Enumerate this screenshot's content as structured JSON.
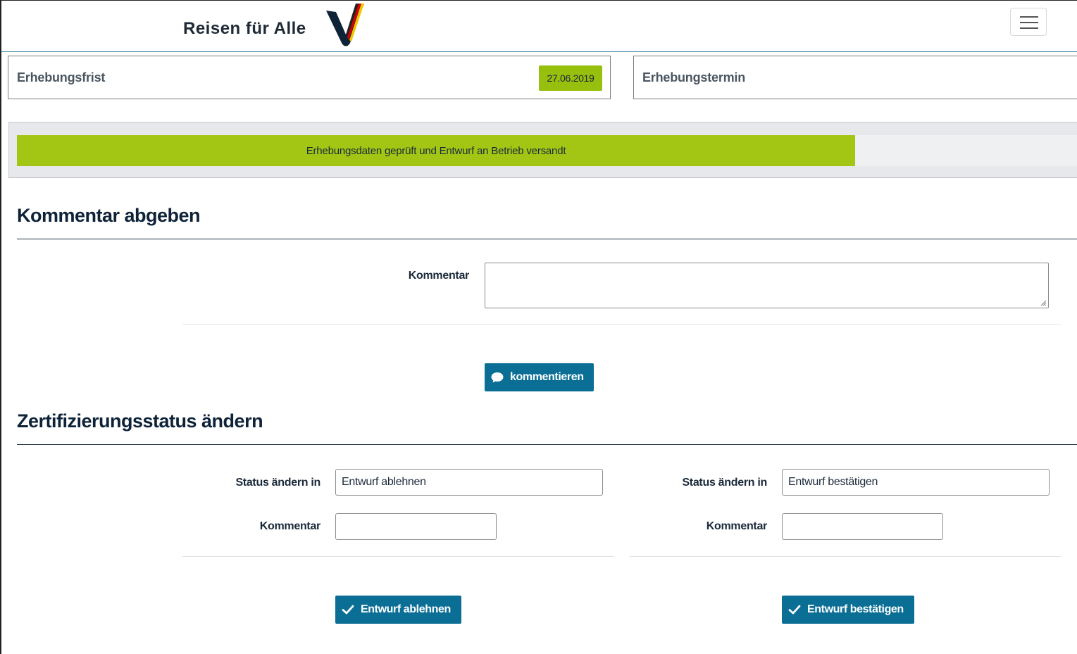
{
  "header": {
    "logo_text": "Reisen für Alle"
  },
  "info": {
    "erhebungsfrist_label": "Erhebungsfrist",
    "erhebungsfrist_date": "27.06.2019",
    "erhebungstermin_label": "Erhebungstermin"
  },
  "progress": {
    "label": "Erhebungsdaten geprüft und Entwurf an Betrieb versandt",
    "fraction": 0.79
  },
  "comment_section": {
    "title": "Kommentar abgeben",
    "comment_label": "Kommentar",
    "comment_value": "",
    "submit_label": "kommentieren"
  },
  "status_section": {
    "title": "Zertifizierungsstatus ändern",
    "reject": {
      "status_label": "Status ändern in",
      "status_value": "Entwurf ablehnen",
      "comment_label": "Kommentar",
      "comment_value": "",
      "button_label": "Entwurf ablehnen"
    },
    "confirm": {
      "status_label": "Status ändern in",
      "status_value": "Entwurf bestätigen",
      "comment_label": "Kommentar",
      "comment_value": "",
      "button_label": "Entwurf bestätigen"
    }
  },
  "colors": {
    "accent_blue": "#0b6f95",
    "accent_green": "#a3c615",
    "badge_green": "#97bf0d"
  },
  "icons": {
    "menu": "hamburger-icon",
    "comment": "speech-bubble-icon",
    "check": "checkmark-icon"
  }
}
